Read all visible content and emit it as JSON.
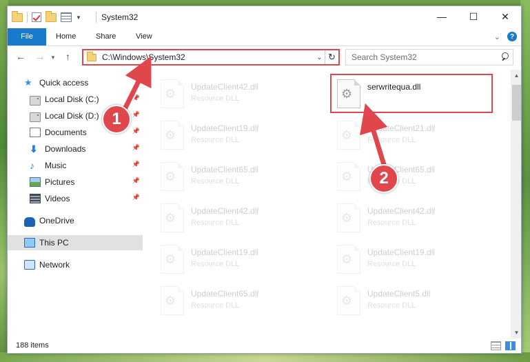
{
  "window": {
    "title": "System32",
    "controls": {
      "minimize": "—",
      "maximize": "☐",
      "close": "✕"
    }
  },
  "ribbon": {
    "tabs": [
      {
        "label": "File"
      },
      {
        "label": "Home"
      },
      {
        "label": "Share"
      },
      {
        "label": "View"
      }
    ],
    "help": "?"
  },
  "navigation": {
    "address": "C:\\Windows\\System32",
    "search_placeholder": "Search System32"
  },
  "sidebar": {
    "items": [
      {
        "label": "Quick access",
        "icon": "star-icon"
      },
      {
        "label": "Local Disk (C:)",
        "icon": "disk-icon"
      },
      {
        "label": "Local Disk (D:)",
        "icon": "disk-icon"
      },
      {
        "label": "Documents",
        "icon": "documents-icon"
      },
      {
        "label": "Downloads",
        "icon": "download-icon"
      },
      {
        "label": "Music",
        "icon": "music-icon"
      },
      {
        "label": "Pictures",
        "icon": "pictures-icon"
      },
      {
        "label": "Videos",
        "icon": "videos-icon"
      },
      {
        "label": "OneDrive",
        "icon": "cloud-icon"
      },
      {
        "label": "This PC",
        "icon": "computer-icon"
      },
      {
        "label": "Network",
        "icon": "network-icon"
      }
    ]
  },
  "files": {
    "left_column": [
      {
        "name": "UpdateClient42.dll",
        "type": "Resource DLL"
      },
      {
        "name": "UpdateClient19.dll",
        "type": "Resource DLL"
      },
      {
        "name": "UpdateClient65.dll",
        "type": "Resource DLL"
      },
      {
        "name": "UpdateClient42.dll",
        "type": "Resource DLL"
      },
      {
        "name": "UpdateClient19.dll",
        "type": "Resource DLL"
      },
      {
        "name": "UpdateClient65.dll",
        "type": "Resource DLL"
      }
    ],
    "right_column": [
      {
        "name": "serwritequa.dll",
        "type": ""
      },
      {
        "name": "UpdateClient21.dll",
        "type": "Resource DLL"
      },
      {
        "name": "UpdateClient65.dll",
        "type": "Resource DLL"
      },
      {
        "name": "UpdateClient42.dll",
        "type": "Resource DLL"
      },
      {
        "name": "UpdateClient19.dll",
        "type": "Resource DLL"
      },
      {
        "name": "UpdateClient5.dll",
        "type": "Resource DLL"
      }
    ]
  },
  "status": {
    "item_count": "188 items"
  },
  "annotations": {
    "step1": "1",
    "step2": "2"
  },
  "colors": {
    "accent": "#1979ca",
    "highlight": "#e0474c"
  }
}
